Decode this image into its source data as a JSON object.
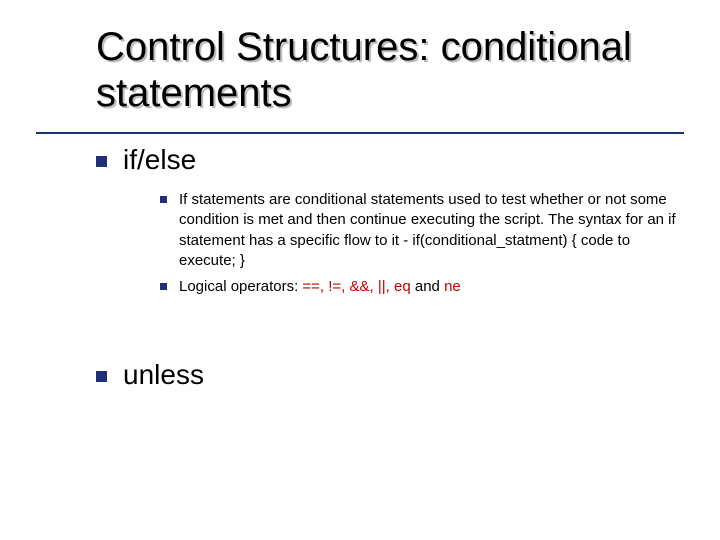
{
  "title": "Control Structures: conditional statements",
  "sections": [
    {
      "label": "if/else",
      "items": [
        {
          "text": "If statements are conditional statements used to test whether or not some condition is met and then continue executing the script. The syntax for an if statement has a specific flow to it - if(conditional_statment) { code to execute; }"
        },
        {
          "prefix": "Logical operators: ",
          "ops_colored": "==, !=, &&, ||, eq",
          "suffix": " and ",
          "last_op": "ne"
        }
      ]
    },
    {
      "label": "unless",
      "items": []
    }
  ]
}
